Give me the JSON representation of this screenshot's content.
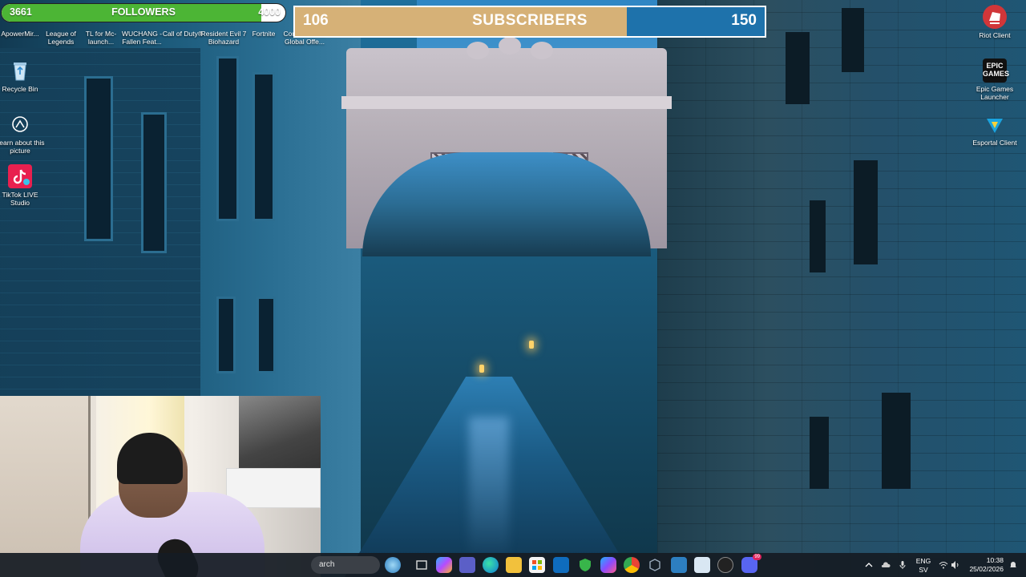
{
  "overlays": {
    "followers": {
      "current": "3661",
      "label": "FOLLOWERS",
      "goal": "4000",
      "progress": 0.915
    },
    "subscribers": {
      "current": "106",
      "label": "SUBSCRIBERS",
      "goal": "150",
      "progress": 0.7067
    }
  },
  "desktop": {
    "left_top_row": [
      {
        "label": "ApowerMir...",
        "icon": "apowermirror-icon"
      },
      {
        "label": "League of Legends",
        "icon": "league-of-legends-icon"
      },
      {
        "label": "TL for Mc-launch...",
        "icon": "tlauncher-icon"
      },
      {
        "label": "WUCHANG - Fallen Feat...",
        "icon": "wuchang-icon"
      },
      {
        "label": "Call of Duty®",
        "icon": "call-of-duty-icon"
      },
      {
        "label": "Resident Evil 7 Biohazard",
        "icon": "resident-evil-icon"
      },
      {
        "label": "Fortnite",
        "icon": "fortnite-icon"
      },
      {
        "label": "Counter-Stri... Global Offe...",
        "icon": "counter-strike-icon"
      }
    ],
    "left_column": [
      {
        "label": "Recycle Bin",
        "icon": "recycle-bin-icon"
      },
      {
        "label": "Learn about this picture",
        "icon": "learn-picture-icon"
      },
      {
        "label": "TikTok LIVE Studio",
        "icon": "tiktok-live-icon"
      }
    ],
    "right_column": [
      {
        "label": "Riot Client",
        "icon": "riot-client-icon"
      },
      {
        "label": "Epic Games Launcher",
        "icon": "epic-games-icon",
        "badge": "EPIC GAMES"
      },
      {
        "label": "Esportal Client",
        "icon": "esportal-icon"
      }
    ]
  },
  "taskbar": {
    "search_text": "arch",
    "apps": [
      "search-animation-icon",
      "task-view-icon",
      "copilot-icon",
      "teams-icon",
      "edge-icon",
      "file-explorer-icon",
      "microsoft-store-icon",
      "outlook-icon",
      "vpn-shield-icon",
      "m365-icon",
      "chrome-icon",
      "app-cube-icon",
      "photos-icon",
      "remote-desktop-icon",
      "obs-icon",
      "discord-icon"
    ],
    "tray": {
      "language": "ENG",
      "layout": "SV",
      "time": "10:38",
      "date": "25/02/2026",
      "discord_badge": "99"
    }
  },
  "colors": {
    "followers_fill": "#4cb535",
    "subscribers_fill": "#d6b177",
    "subscribers_bg": "#1e72ab"
  }
}
